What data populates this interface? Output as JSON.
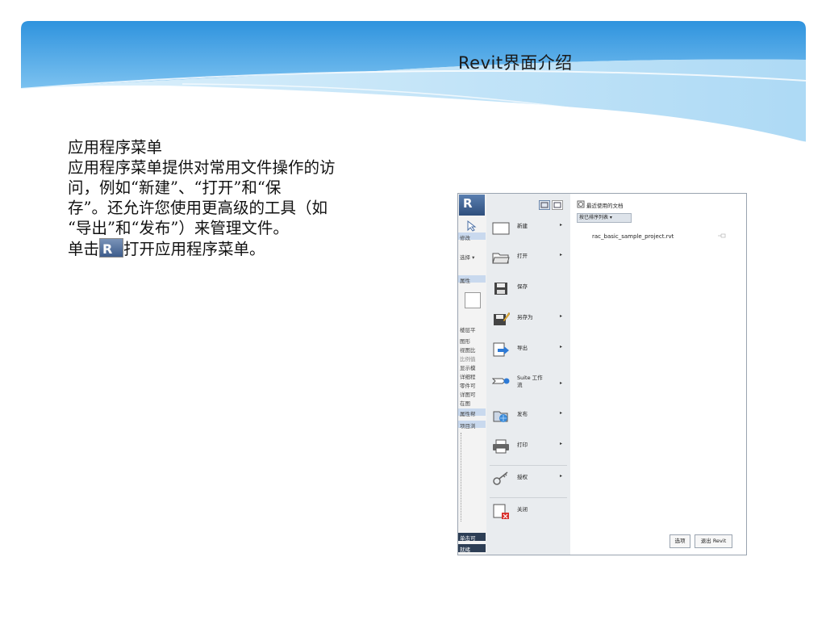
{
  "slide": {
    "title": "Revit界面介绍",
    "heading": "应用程序菜单",
    "line1": "应用程序菜单提供对常用文件操作的访",
    "line2": "问，例如“新建”、“打开”和“保",
    "line3": "存”。还允许您使用更高级的工具（如",
    "line4": "“导出”和“发布”）来管理文件。",
    "line5_pre": "单击",
    "line5_post": "打开应用程序菜单。",
    "logo_letter": "R"
  },
  "screenshot": {
    "app_letter": "R",
    "strip_labels": [
      "修改",
      "选择 ▾",
      "属性",
      "楼层平",
      "图形",
      "视图比",
      "比例值",
      "显示模",
      "详细程",
      "零件可",
      "详图可",
      "在图",
      "属性帮",
      "项目浏",
      "单击可",
      "就绪"
    ],
    "menu": [
      {
        "label": "新建",
        "arrow": true
      },
      {
        "label": "打开",
        "arrow": true
      },
      {
        "label": "保存",
        "arrow": false
      },
      {
        "label": "另存为",
        "arrow": true
      },
      {
        "label": "导出",
        "arrow": true
      },
      {
        "label": "Suite 工作流",
        "arrow": true
      },
      {
        "label": "发布",
        "arrow": true
      },
      {
        "label": "打印",
        "arrow": true
      },
      {
        "label": "授权",
        "arrow": true
      },
      {
        "label": "关闭",
        "arrow": false
      }
    ],
    "recent_title": "最近使用的文档",
    "order_label": "按已排序列表 ▾",
    "recent_file": "rac_basic_sample_project.rvt",
    "options_button": "选项",
    "exit_button": "退出 Revit"
  },
  "colors": {
    "banner_blue": "#2a8fdc",
    "banner_light": "#bfe1f7",
    "menu_bg": "#e9ecef"
  }
}
